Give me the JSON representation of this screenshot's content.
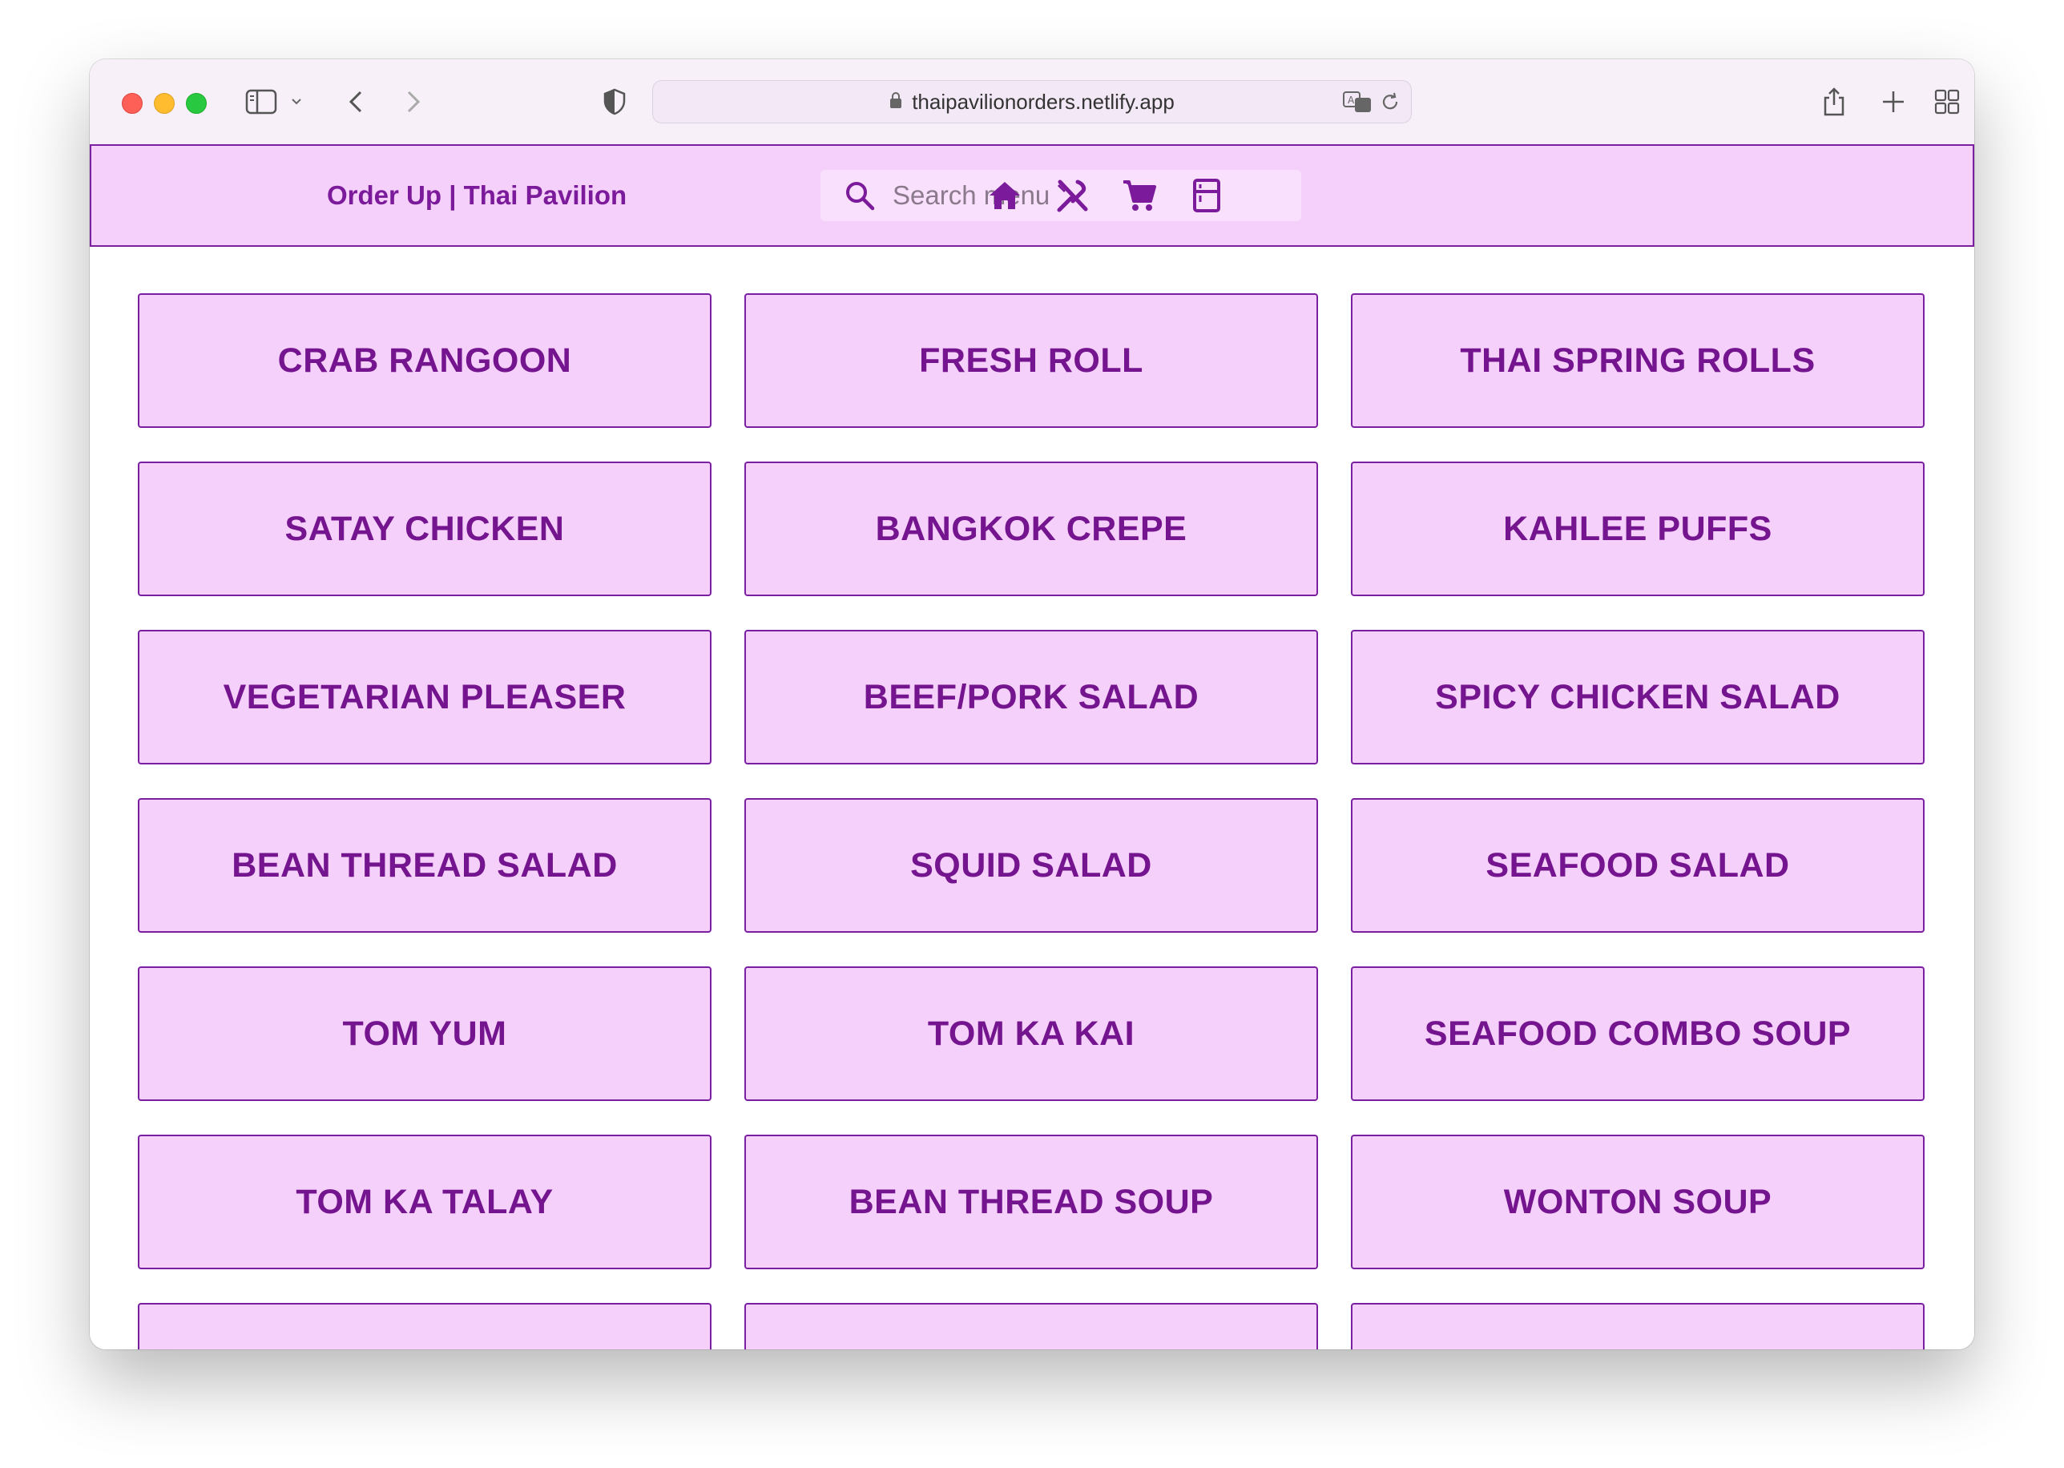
{
  "browser": {
    "url": "thaipavilionorders.netlify.app"
  },
  "header": {
    "brand": "Order Up | Thai Pavilion",
    "search_placeholder": "Search menu",
    "nav_icons": [
      "home-icon",
      "restaurant-icon",
      "cart-icon",
      "kitchen-icon"
    ]
  },
  "colors": {
    "accent": "#7a1fa2",
    "tile_bg": "#f5d0fa",
    "text": "#74148f"
  },
  "menu_items": [
    "CRAB RANGOON",
    "FRESH ROLL",
    "THAI SPRING ROLLS",
    "SATAY CHICKEN",
    "BANGKOK CREPE",
    "KAHLEE PUFFS",
    "VEGETARIAN PLEASER",
    "BEEF/PORK SALAD",
    "SPICY CHICKEN SALAD",
    "BEAN THREAD SALAD",
    "SQUID SALAD",
    "SEAFOOD SALAD",
    "TOM YUM",
    "TOM KA KAI",
    "SEAFOOD COMBO SOUP",
    "TOM KA TALAY",
    "BEAN THREAD SOUP",
    "WONTON SOUP",
    "",
    "",
    ""
  ]
}
